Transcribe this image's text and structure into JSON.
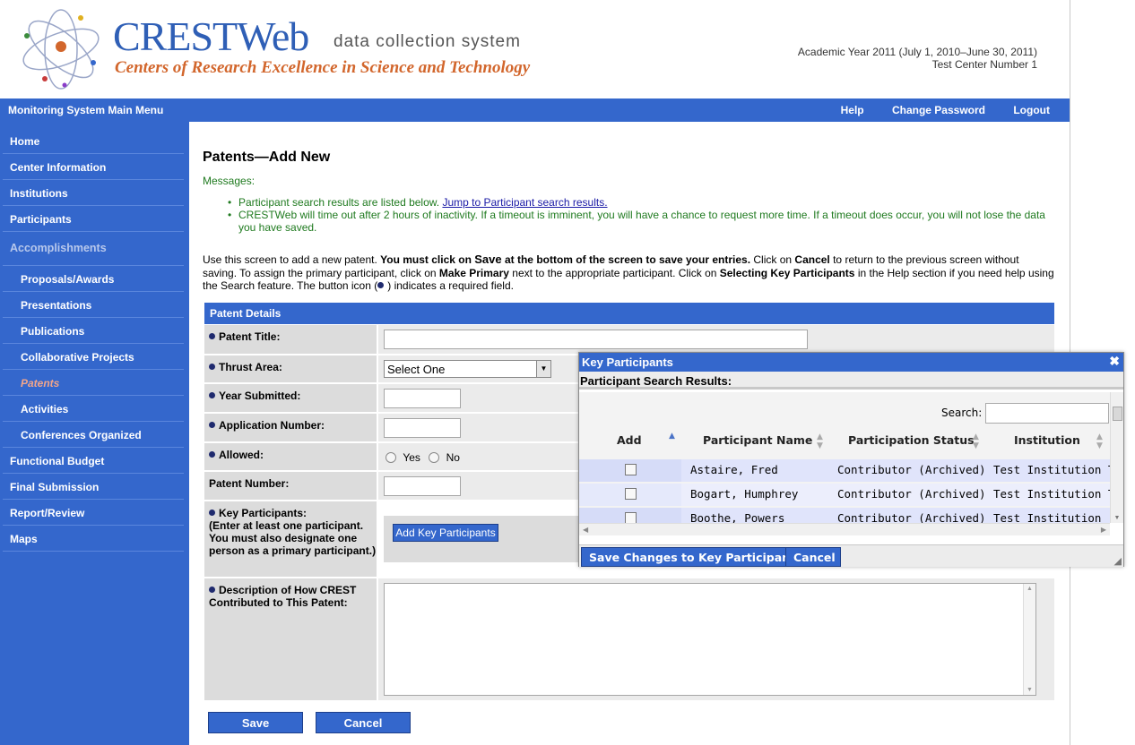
{
  "header": {
    "logo_title": "CRESTWeb",
    "logo_tagline": "data collection system",
    "logo_subtitle": "Centers of Research Excellence in Science and Technology",
    "academic_year": "Academic Year 2011 (July 1, 2010–June 30, 2011)",
    "center": "Test Center Number 1"
  },
  "topnav": {
    "main_menu": "Monitoring System Main Menu",
    "help": "Help",
    "change_password": "Change Password",
    "logout": "Logout"
  },
  "sidebar": {
    "items": [
      {
        "label": "Home"
      },
      {
        "label": "Center Information"
      },
      {
        "label": "Institutions"
      },
      {
        "label": "Participants"
      },
      {
        "label": "Accomplishments"
      },
      {
        "label": "Proposals/Awards"
      },
      {
        "label": "Presentations"
      },
      {
        "label": "Publications"
      },
      {
        "label": "Collaborative Projects"
      },
      {
        "label": "Patents"
      },
      {
        "label": "Activities"
      },
      {
        "label": "Conferences Organized"
      },
      {
        "label": "Functional Budget"
      },
      {
        "label": "Final Submission"
      },
      {
        "label": "Report/Review"
      },
      {
        "label": "Maps"
      }
    ]
  },
  "main": {
    "title": "Patents—Add New",
    "messages_label": "Messages:",
    "msg1_text": "Participant search results are listed below. ",
    "msg1_link": "Jump to Participant search results.",
    "msg2": "CRESTWeb will time out after 2 hours of inactivity. If a timeout is imminent, you will have a chance to request more time. If a timeout does occur, you will not lose the data you have saved.",
    "instr": {
      "p1": "Use this screen to add a new patent. ",
      "p2": "You must click on ",
      "p3": "Save",
      "p4": " at the bottom of the screen to save your entries.",
      "p5": " Click on ",
      "p6": "Cancel",
      "p7": " to return to the previous screen without saving. To assign the primary participant, click on ",
      "p8": "Make Primary",
      "p9": " next to the appropriate participant. Click on ",
      "p10": "Selecting Key Participants",
      "p11": " in the Help section if you need help using the Search feature. The button icon (",
      "p12": ") indicates a required field."
    }
  },
  "form": {
    "header": "Patent Details",
    "patent_title_label": "Patent Title:",
    "thrust_label": "Thrust Area:",
    "thrust_value": "Select One",
    "year_label": "Year Submitted:",
    "app_label": "Application Number:",
    "allowed_label": "Allowed:",
    "yes": "Yes",
    "no": "No",
    "patent_number_label": "Patent Number:",
    "key_label": "Key Participants:",
    "key_note": "(Enter at least one participant. You must also designate one person as a primary participant.)",
    "add_key_btn": "Add Key Participants",
    "desc_label": "Description of How CREST Contributed to This Patent:",
    "save": "Save",
    "cancel": "Cancel"
  },
  "dialog": {
    "title": "Key Participants",
    "results_label": "Participant Search Results:",
    "search_label": "Search:",
    "columns": [
      "Add",
      "Participant Name",
      "Participation Status",
      "Institution"
    ],
    "rows": [
      {
        "name": "Astaire, Fred",
        "status": "Contributor (Archived)",
        "institution": "Test Institution Ten"
      },
      {
        "name": "Bogart, Humphrey",
        "status": "Contributor (Archived)",
        "institution": "Test Institution Ten"
      },
      {
        "name": "Boothe, Powers",
        "status": "Contributor (Archived)",
        "institution": "Test Institution"
      }
    ],
    "save_btn": "Save Changes to Key Participants",
    "cancel_btn": "Cancel"
  },
  "colors": {
    "brand_blue": "#3467cc",
    "message_green": "#1f7a1f",
    "active_nav": "#f2a58a",
    "logo_orange": "#d2662c"
  }
}
